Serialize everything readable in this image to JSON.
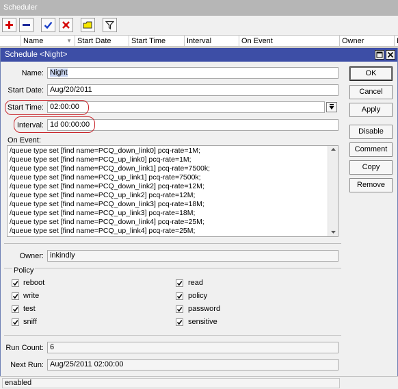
{
  "outer_window": {
    "title": "Scheduler"
  },
  "toolbar": {
    "buttons": [
      {
        "name": "add",
        "icon": "plus-icon",
        "color": "#d40000"
      },
      {
        "name": "remove",
        "icon": "minus-icon",
        "color": "#1d2a9a"
      },
      {
        "name": "enable",
        "icon": "check-icon",
        "color": "#1a3fc8"
      },
      {
        "name": "disable",
        "icon": "x-icon",
        "color": "#d40000"
      },
      {
        "name": "comment",
        "icon": "folder-note-icon",
        "color": "#e6d400"
      },
      {
        "name": "filter",
        "icon": "filter-icon",
        "color": "#222222"
      }
    ]
  },
  "table": {
    "columns": [
      "Name",
      "Start Date",
      "Start Time",
      "Interval",
      "On Event",
      "Owner",
      "R"
    ]
  },
  "dialog": {
    "title": "Schedule <Night>",
    "fields": {
      "name_label": "Name:",
      "name_value": "Night",
      "start_date_label": "Start Date:",
      "start_date_value": "Aug/20/2011",
      "start_time_label": "Start Time:",
      "start_time_value": "02:00:00",
      "interval_label": "Interval:",
      "interval_value": "1d 00:00:00",
      "on_event_label": "On Event:",
      "owner_label": "Owner:",
      "owner_value": "inkindly",
      "run_count_label": "Run Count:",
      "run_count_value": "6",
      "next_run_label": "Next Run:",
      "next_run_value": "Aug/25/2011 02:00:00"
    },
    "on_event_lines": [
      "/queue type set [find name=PCQ_down_link0] pcq-rate=1M;",
      "/queue type set [find name=PCQ_up_link0] pcq-rate=1M;",
      "/queue type set [find name=PCQ_down_link1] pcq-rate=7500k;",
      "/queue type set [find name=PCQ_up_link1] pcq-rate=7500k;",
      "/queue type set [find name=PCQ_down_link2] pcq-rate=12M;",
      "/queue type set [find name=PCQ_up_link2] pcq-rate=12M;",
      "/queue type set [find name=PCQ_down_link3] pcq-rate=18M;",
      "/queue type set [find name=PCQ_up_link3] pcq-rate=18M;",
      "/queue type set [find name=PCQ_down_link4] pcq-rate=25M;",
      "/queue type set [find name=PCQ_up_link4] pcq-rate=25M;"
    ],
    "policy": {
      "title": "Policy",
      "items": [
        {
          "label": "reboot",
          "checked": true
        },
        {
          "label": "write",
          "checked": true
        },
        {
          "label": "test",
          "checked": true
        },
        {
          "label": "sniff",
          "checked": true
        },
        {
          "label": "read",
          "checked": true
        },
        {
          "label": "policy",
          "checked": true
        },
        {
          "label": "password",
          "checked": true
        },
        {
          "label": "sensitive",
          "checked": true
        }
      ]
    },
    "buttons": {
      "ok": "OK",
      "cancel": "Cancel",
      "apply": "Apply",
      "disable": "Disable",
      "comment": "Comment",
      "copy": "Copy",
      "remove": "Remove"
    },
    "status": "enabled"
  },
  "colors": {
    "dialog_title_bg": "#3d4ea6",
    "highlight_oval": "#c8262c",
    "name_highlight": "#c8d4f0"
  }
}
